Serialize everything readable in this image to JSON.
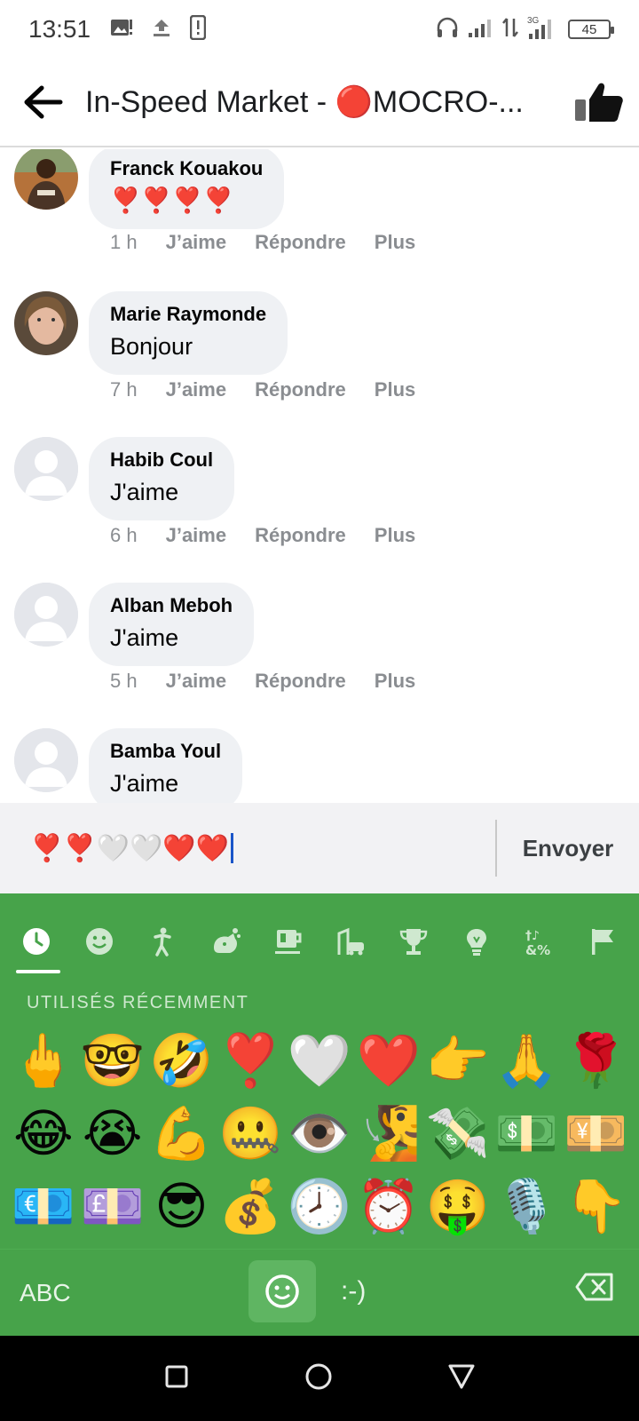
{
  "status_bar": {
    "time": "13:51",
    "battery": "45",
    "network": "3G"
  },
  "header": {
    "title": "In-Speed Market - 🔴MOCRO-..."
  },
  "comments": [
    {
      "name": "Franck Kouakou",
      "text": "❣️❣️❣️❣️",
      "time": "1 h",
      "like": "J’aime",
      "reply": "Répondre",
      "more": "Plus",
      "avatar": "photo"
    },
    {
      "name": "Marie Raymonde",
      "text": "Bonjour",
      "time": "7 h",
      "like": "J’aime",
      "reply": "Répondre",
      "more": "Plus",
      "avatar": "photo"
    },
    {
      "name": "Habib Coul",
      "text": "J'aime",
      "time": "6 h",
      "like": "J’aime",
      "reply": "Répondre",
      "more": "Plus",
      "avatar": "default"
    },
    {
      "name": "Alban Meboh",
      "text": "J'aime",
      "time": "5 h",
      "like": "J’aime",
      "reply": "Répondre",
      "more": "Plus",
      "avatar": "default"
    },
    {
      "name": "Bamba Youl",
      "text": "J'aime",
      "time": "",
      "like": "",
      "reply": "",
      "more": "",
      "avatar": "default"
    }
  ],
  "composer": {
    "value": "❣️❣️🤍🤍❤️❤️",
    "send_label": "Envoyer"
  },
  "keyboard": {
    "section_label": "UTILISÉS RÉCEMMENT",
    "tabs": [
      "recent-clock-icon",
      "smiley-icon",
      "person-icon",
      "animal-icon",
      "food-cup-icon",
      "travel-icon",
      "trophy-icon",
      "lightbulb-icon",
      "symbols-icon",
      "flag-icon"
    ],
    "emojis": [
      "🖕",
      "🤓",
      "🤣",
      "❣️",
      "🤍",
      "❤️",
      "👉",
      "🙏",
      "🌹",
      "😂",
      "😭",
      "💪",
      "🤐",
      "👁️",
      "🧏",
      "💸",
      "💵",
      "💴",
      "💶",
      "💷",
      "😎",
      "💰",
      "🕗",
      "⏰",
      "🤑",
      "🎙️",
      "👇"
    ],
    "abc_label": "ABC",
    "emoticon_label": ":-)"
  },
  "colors": {
    "keyboard_bg": "#47a34a",
    "bubble_bg": "#eff1f4",
    "caret": "#1a55c8"
  }
}
